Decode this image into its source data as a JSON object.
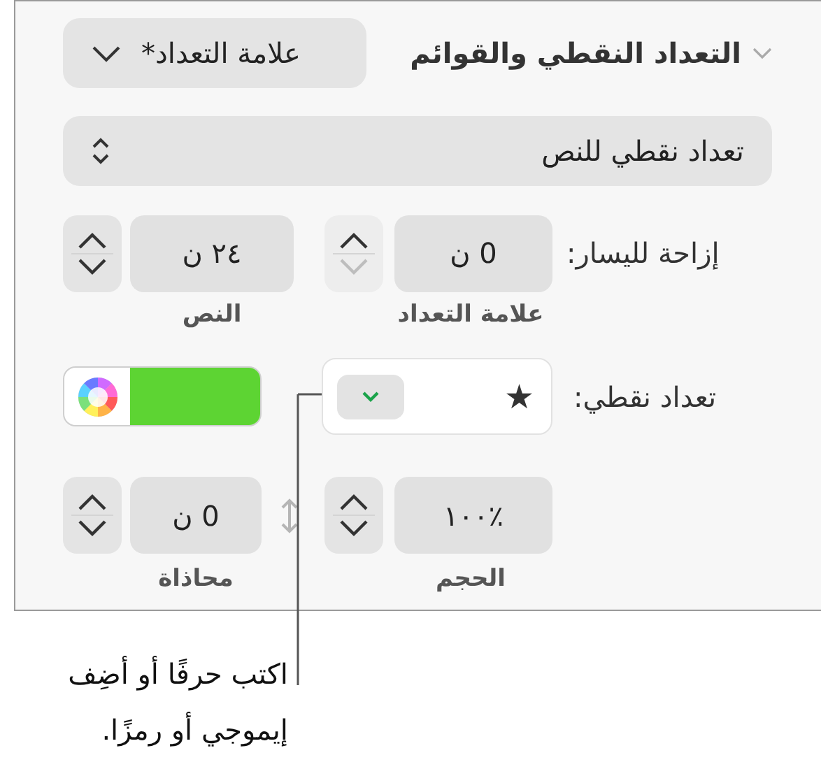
{
  "section": {
    "title": "التعداد النقطي والقوائم",
    "expanded": true
  },
  "style_popup": {
    "value": "علامة التعداد*"
  },
  "list_type_popup": {
    "value": "تعداد نقطي للنص"
  },
  "indent": {
    "label": "إزاحة لليسار:",
    "fields": [
      {
        "value": "0 ن",
        "caption": "علامة التعداد",
        "up_disabled": false,
        "down_disabled": true
      },
      {
        "value": "٢٤ ن",
        "caption": "النص",
        "up_disabled": false,
        "down_disabled": false
      }
    ]
  },
  "bullet": {
    "label": "تعداد نقطي:",
    "symbol": "★",
    "color": "#5dd433"
  },
  "size": {
    "value": "٪١٠٠",
    "caption": "الحجم",
    "up_disabled": false,
    "down_disabled": false
  },
  "align": {
    "value": "0 ن",
    "caption": "محاذاة",
    "up_disabled": false,
    "down_disabled": false
  },
  "callout": "اكتب حرفًا أو أضِف\nإيموجي أو رمزًا."
}
